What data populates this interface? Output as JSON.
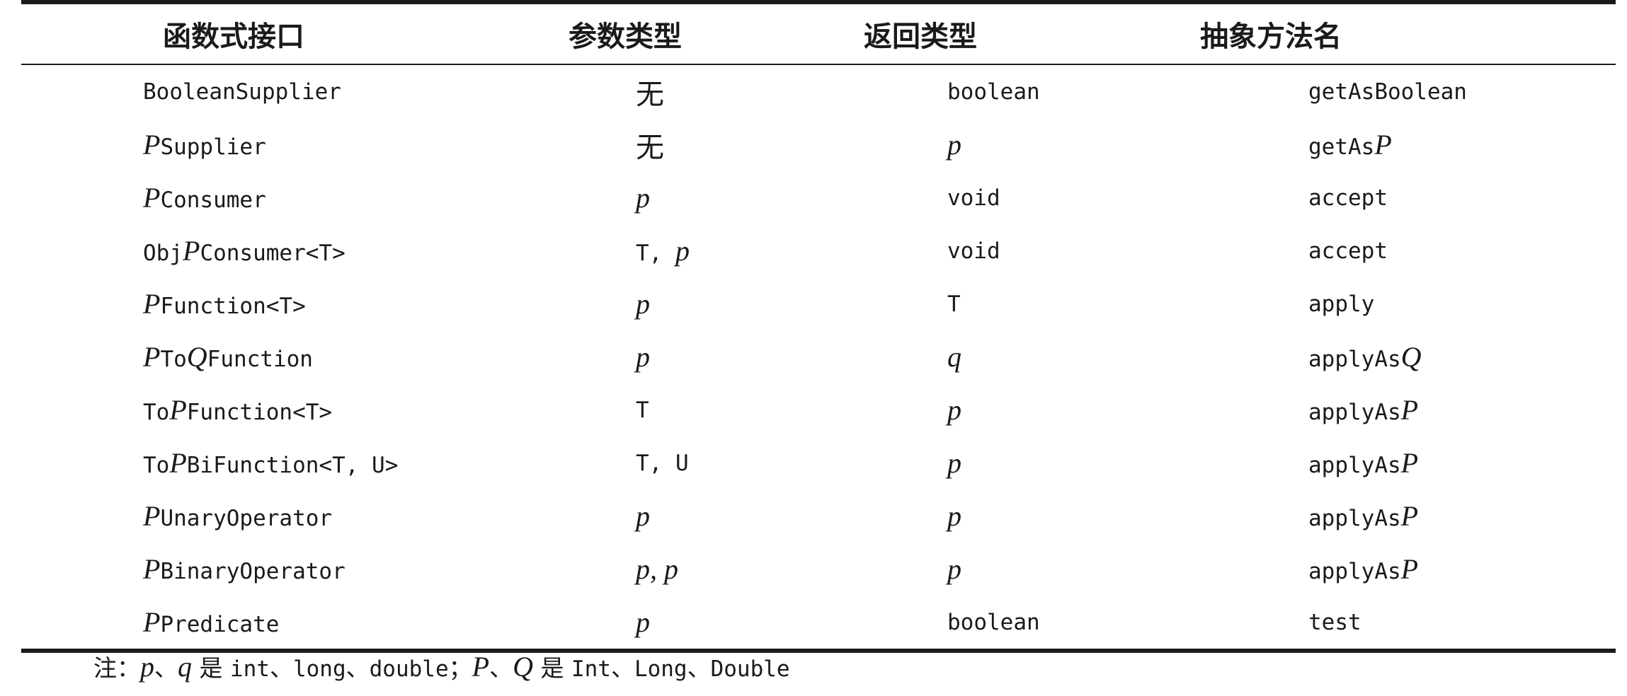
{
  "table": {
    "headers": [
      "函数式接口",
      "参数类型",
      "返回类型",
      "抽象方法名"
    ],
    "rows": [
      {
        "interface": [
          {
            "t": "BooleanSupplier",
            "s": "mono"
          }
        ],
        "param": [
          {
            "t": "无",
            "s": "cjk"
          }
        ],
        "ret": [
          {
            "t": "boolean",
            "s": "mono"
          }
        ],
        "method": [
          {
            "t": "getAsBoolean",
            "s": "mono"
          }
        ]
      },
      {
        "interface": [
          {
            "t": "P",
            "s": "it"
          },
          {
            "t": "Supplier",
            "s": "mono"
          }
        ],
        "param": [
          {
            "t": "无",
            "s": "cjk"
          }
        ],
        "ret": [
          {
            "t": "p",
            "s": "it"
          }
        ],
        "method": [
          {
            "t": "getAs",
            "s": "mono"
          },
          {
            "t": "P",
            "s": "it"
          }
        ]
      },
      {
        "interface": [
          {
            "t": "P",
            "s": "it"
          },
          {
            "t": "Consumer",
            "s": "mono"
          }
        ],
        "param": [
          {
            "t": "p",
            "s": "it"
          }
        ],
        "ret": [
          {
            "t": "void",
            "s": "mono"
          }
        ],
        "method": [
          {
            "t": "accept",
            "s": "mono"
          }
        ]
      },
      {
        "interface": [
          {
            "t": "Obj",
            "s": "mono"
          },
          {
            "t": "P",
            "s": "it"
          },
          {
            "t": "Consumer<T>",
            "s": "mono"
          }
        ],
        "param": [
          {
            "t": "T, ",
            "s": "mono"
          },
          {
            "t": "p",
            "s": "it"
          }
        ],
        "ret": [
          {
            "t": "void",
            "s": "mono"
          }
        ],
        "method": [
          {
            "t": "accept",
            "s": "mono"
          }
        ]
      },
      {
        "interface": [
          {
            "t": "P",
            "s": "it"
          },
          {
            "t": "Function<T>",
            "s": "mono"
          }
        ],
        "param": [
          {
            "t": "p",
            "s": "it"
          }
        ],
        "ret": [
          {
            "t": "T",
            "s": "mono"
          }
        ],
        "method": [
          {
            "t": "apply",
            "s": "mono"
          }
        ]
      },
      {
        "interface": [
          {
            "t": "P",
            "s": "it"
          },
          {
            "t": "To",
            "s": "mono"
          },
          {
            "t": "Q",
            "s": "it"
          },
          {
            "t": "Function",
            "s": "mono"
          }
        ],
        "param": [
          {
            "t": "p",
            "s": "it"
          }
        ],
        "ret": [
          {
            "t": "q",
            "s": "it"
          }
        ],
        "method": [
          {
            "t": "applyAs",
            "s": "mono"
          },
          {
            "t": "Q",
            "s": "it"
          }
        ]
      },
      {
        "interface": [
          {
            "t": "To",
            "s": "mono"
          },
          {
            "t": "P",
            "s": "it"
          },
          {
            "t": "Function<T>",
            "s": "mono"
          }
        ],
        "param": [
          {
            "t": "T",
            "s": "mono"
          }
        ],
        "ret": [
          {
            "t": "p",
            "s": "it"
          }
        ],
        "method": [
          {
            "t": "applyAs",
            "s": "mono"
          },
          {
            "t": "P",
            "s": "it"
          }
        ]
      },
      {
        "interface": [
          {
            "t": "To",
            "s": "mono"
          },
          {
            "t": "P",
            "s": "it"
          },
          {
            "t": "BiFunction<T, U>",
            "s": "mono"
          }
        ],
        "param": [
          {
            "t": "T, U",
            "s": "mono"
          }
        ],
        "ret": [
          {
            "t": "p",
            "s": "it"
          }
        ],
        "method": [
          {
            "t": "applyAs",
            "s": "mono"
          },
          {
            "t": "P",
            "s": "it"
          }
        ]
      },
      {
        "interface": [
          {
            "t": "P",
            "s": "it"
          },
          {
            "t": "UnaryOperator",
            "s": "mono"
          }
        ],
        "param": [
          {
            "t": "p",
            "s": "it"
          }
        ],
        "ret": [
          {
            "t": "p",
            "s": "it"
          }
        ],
        "method": [
          {
            "t": "applyAs",
            "s": "mono"
          },
          {
            "t": "P",
            "s": "it"
          }
        ]
      },
      {
        "interface": [
          {
            "t": "P",
            "s": "it"
          },
          {
            "t": "BinaryOperator",
            "s": "mono"
          }
        ],
        "param": [
          {
            "t": "p, p",
            "s": "it"
          }
        ],
        "ret": [
          {
            "t": "p",
            "s": "it"
          }
        ],
        "method": [
          {
            "t": "applyAs",
            "s": "mono"
          },
          {
            "t": "P",
            "s": "it"
          }
        ]
      },
      {
        "interface": [
          {
            "t": "P",
            "s": "it"
          },
          {
            "t": "Predicate",
            "s": "mono"
          }
        ],
        "param": [
          {
            "t": "p",
            "s": "it"
          }
        ],
        "ret": [
          {
            "t": "boolean",
            "s": "mono"
          }
        ],
        "method": [
          {
            "t": "test",
            "s": "mono"
          }
        ]
      }
    ]
  },
  "note": [
    {
      "t": "注：",
      "s": "lbl"
    },
    {
      "t": "p",
      "s": "it"
    },
    {
      "t": "、",
      "s": "lbl"
    },
    {
      "t": "q",
      "s": "it"
    },
    {
      "t": " 是 ",
      "s": "lbl"
    },
    {
      "t": "int",
      "s": "mono"
    },
    {
      "t": "、",
      "s": "lbl"
    },
    {
      "t": "long",
      "s": "mono"
    },
    {
      "t": "、",
      "s": "lbl"
    },
    {
      "t": "double",
      "s": "mono"
    },
    {
      "t": "；",
      "s": "lbl"
    },
    {
      "t": "P",
      "s": "it"
    },
    {
      "t": "、",
      "s": "lbl"
    },
    {
      "t": "Q",
      "s": "it"
    },
    {
      "t": " 是 ",
      "s": "lbl"
    },
    {
      "t": "Int",
      "s": "mono"
    },
    {
      "t": "、",
      "s": "lbl"
    },
    {
      "t": "Long",
      "s": "mono"
    },
    {
      "t": "、",
      "s": "lbl"
    },
    {
      "t": "Double",
      "s": "mono"
    }
  ]
}
